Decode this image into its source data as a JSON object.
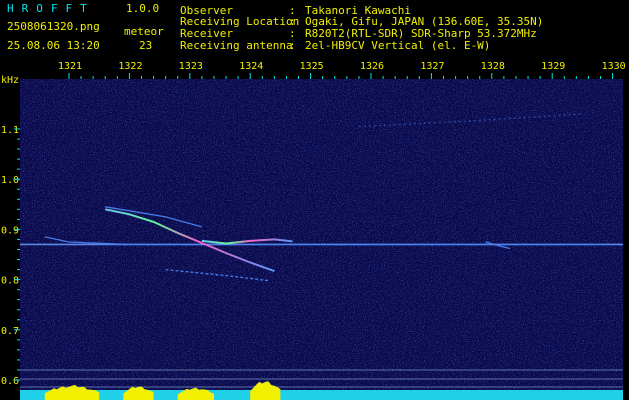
{
  "header": {
    "app_title": "HROFFT",
    "version": "1.0.0",
    "filename": "2508061320.png",
    "mode_label": "meteor",
    "datetime": "25.08.06 13:20",
    "meteor_count": "23",
    "info": [
      {
        "label": "Observer",
        "value": "Takanori Kawachi"
      },
      {
        "label": "Receiving Location",
        "value": "Ogaki, Gifu, JAPAN (136.60E, 35.35N)"
      },
      {
        "label": "Receiver",
        "value": "R820T2(RTL-SDR) SDR-Sharp 53.372MHz"
      },
      {
        "label": "Receiving antenna",
        "value": "2el-HB9CV Vertical (el. E-W)"
      }
    ]
  },
  "colors": {
    "cyan": "#00e6f0",
    "yellow": "#f0f000",
    "background": "#0a0a4a"
  },
  "chart_data": {
    "type": "heatmap",
    "description_units": {
      "x": "time (hhmm)",
      "y": "kHz"
    },
    "y_unit_label": "kHz",
    "x_ticks": [
      "1321",
      "1322",
      "1323",
      "1324",
      "1325",
      "1326",
      "1327",
      "1328",
      "1329",
      "1330"
    ],
    "y_ticks": [
      "1.1",
      "1.0",
      "0.9",
      "0.8",
      "0.7",
      "0.6"
    ],
    "y_range": [
      0.6,
      1.15
    ],
    "x_range": [
      1320.6,
      1330.0
    ],
    "carrier_freq_khz": 0.87,
    "traces": [
      {
        "points": [
          [
            1320.6,
            0.885
          ],
          [
            1321.0,
            0.875
          ],
          [
            1322.0,
            0.87
          ],
          [
            1323.0,
            0.87
          ],
          [
            1324.0,
            0.87
          ],
          [
            1325.0,
            0.87
          ],
          [
            1326.0,
            0.87
          ],
          [
            1327.0,
            0.87
          ],
          [
            1328.0,
            0.87
          ],
          [
            1330.0,
            0.87
          ]
        ]
      },
      {
        "points": [
          [
            1321.6,
            0.94
          ],
          [
            1322.0,
            0.93
          ],
          [
            1322.4,
            0.915
          ],
          [
            1322.8,
            0.893
          ],
          [
            1323.2,
            0.873
          ],
          [
            1323.6,
            0.853
          ],
          [
            1324.0,
            0.834
          ],
          [
            1324.4,
            0.817
          ]
        ]
      },
      {
        "points": [
          [
            1321.6,
            0.945
          ],
          [
            1322.0,
            0.937
          ],
          [
            1322.6,
            0.925
          ],
          [
            1323.2,
            0.905
          ]
        ]
      },
      {
        "points": [
          [
            1323.2,
            0.877
          ],
          [
            1323.6,
            0.872
          ],
          [
            1324.0,
            0.877
          ],
          [
            1324.4,
            0.88
          ],
          [
            1324.7,
            0.876
          ]
        ]
      },
      {
        "points": [
          [
            1327.9,
            0.875
          ],
          [
            1328.1,
            0.868
          ],
          [
            1328.3,
            0.862
          ]
        ]
      },
      {
        "points": [
          [
            1322.6,
            0.82
          ],
          [
            1323.6,
            0.808
          ],
          [
            1324.3,
            0.798
          ]
        ]
      },
      {
        "points": [
          [
            1325.8,
            1.105
          ],
          [
            1327.5,
            1.115
          ],
          [
            1329.5,
            1.13
          ]
        ]
      }
    ],
    "audio_level_bands": [
      {
        "from": 1320.6,
        "to": 1321.5,
        "level": 0.6
      },
      {
        "from": 1321.9,
        "to": 1322.4,
        "level": 0.55
      },
      {
        "from": 1322.8,
        "to": 1323.4,
        "level": 0.45
      },
      {
        "from": 1324.0,
        "to": 1324.5,
        "level": 0.9
      }
    ]
  }
}
